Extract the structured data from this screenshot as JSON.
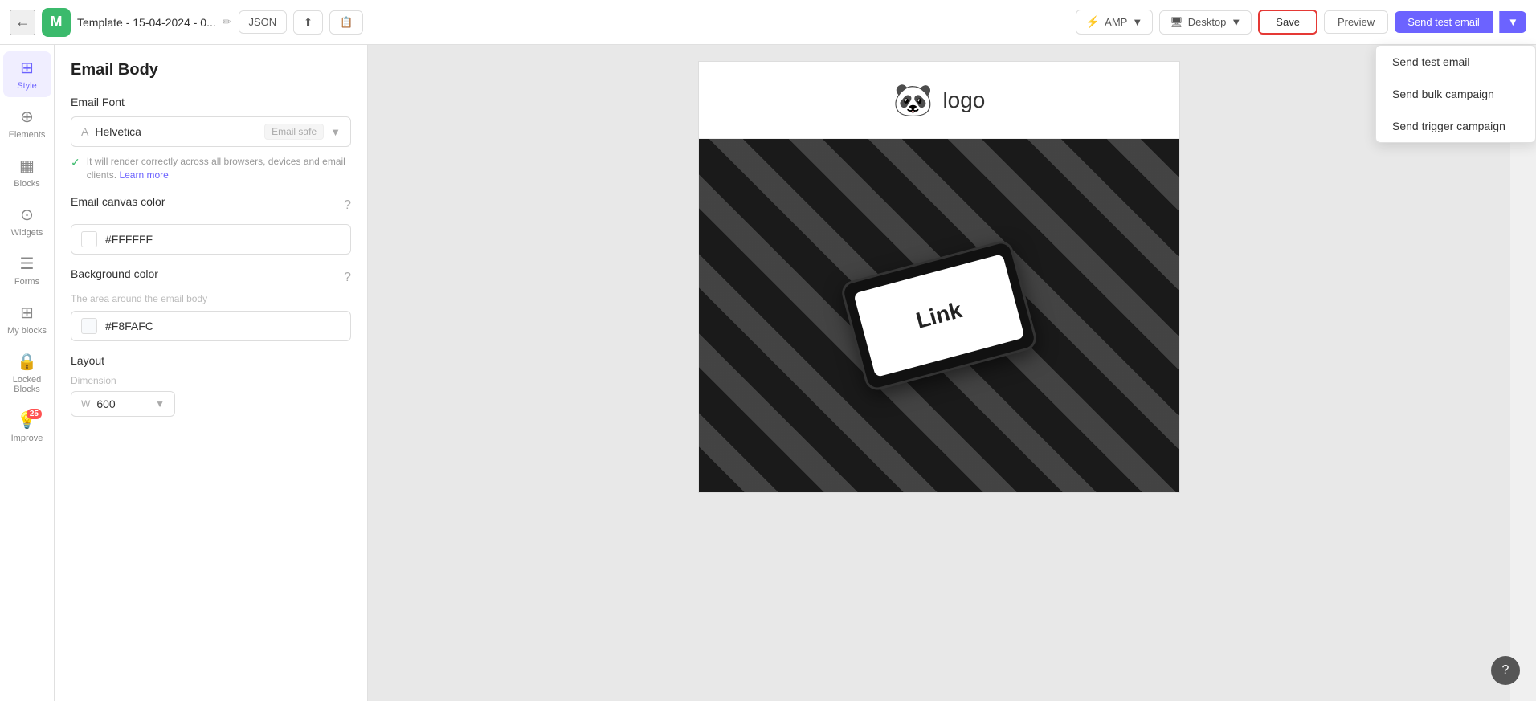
{
  "topbar": {
    "back_icon": "←",
    "logo_text": "M",
    "template_name": "Template - 15-04-2024 - 0...",
    "edit_icon": "✏",
    "json_label": "JSON",
    "share_icon": "⬆",
    "notes_icon": "📋",
    "amp_label": "AMP",
    "amp_icon": "⚡",
    "desktop_label": "Desktop",
    "desktop_icon": "🖥",
    "save_label": "Save",
    "preview_label": "Preview",
    "send_test_label": "Send test email",
    "send_test_dropdown_icon": "▼"
  },
  "dropdown": {
    "items": [
      {
        "label": "Send test email"
      },
      {
        "label": "Send bulk campaign"
      },
      {
        "label": "Send trigger campaign"
      }
    ]
  },
  "sidebar": {
    "items": [
      {
        "id": "style",
        "label": "Style",
        "icon": "⊞",
        "active": true
      },
      {
        "id": "elements",
        "label": "Elements",
        "icon": "⊕"
      },
      {
        "id": "blocks",
        "label": "Blocks",
        "icon": "▦"
      },
      {
        "id": "widgets",
        "label": "Widgets",
        "icon": "⊙"
      },
      {
        "id": "forms",
        "label": "Forms",
        "icon": "☰"
      },
      {
        "id": "my-blocks",
        "label": "My blocks",
        "icon": "⊞"
      },
      {
        "id": "locked-blocks",
        "label": "Locked Blocks",
        "icon": "🔒"
      },
      {
        "id": "improve",
        "label": "Improve",
        "icon": "💡",
        "badge": "25"
      }
    ]
  },
  "panel": {
    "title": "Email Body",
    "email_font_label": "Email Font",
    "font_icon": "A",
    "font_name": "Helvetica",
    "email_safe_label": "Email safe",
    "hint_text": "It will render correctly across all browsers, devices and email clients.",
    "learn_more": "Learn more",
    "canvas_color_label": "Email canvas color",
    "canvas_color_value": "#FFFFFF",
    "canvas_color_hex": "#FFFFFF",
    "bg_color_label": "Background color",
    "bg_color_description": "The area around the email body",
    "bg_color_value": "#F8FAFC",
    "bg_color_hex": "#F8FAFC",
    "layout_label": "Layout",
    "dimension_label": "Dimension",
    "width_label": "W",
    "width_value": "600"
  },
  "email_preview": {
    "logo_icon": "🐼",
    "logo_text": "logo",
    "link_text": "Link"
  },
  "colors": {
    "accent": "#6c63ff",
    "save_border": "#e53935",
    "canvas_bg": "#e8e8e8"
  }
}
